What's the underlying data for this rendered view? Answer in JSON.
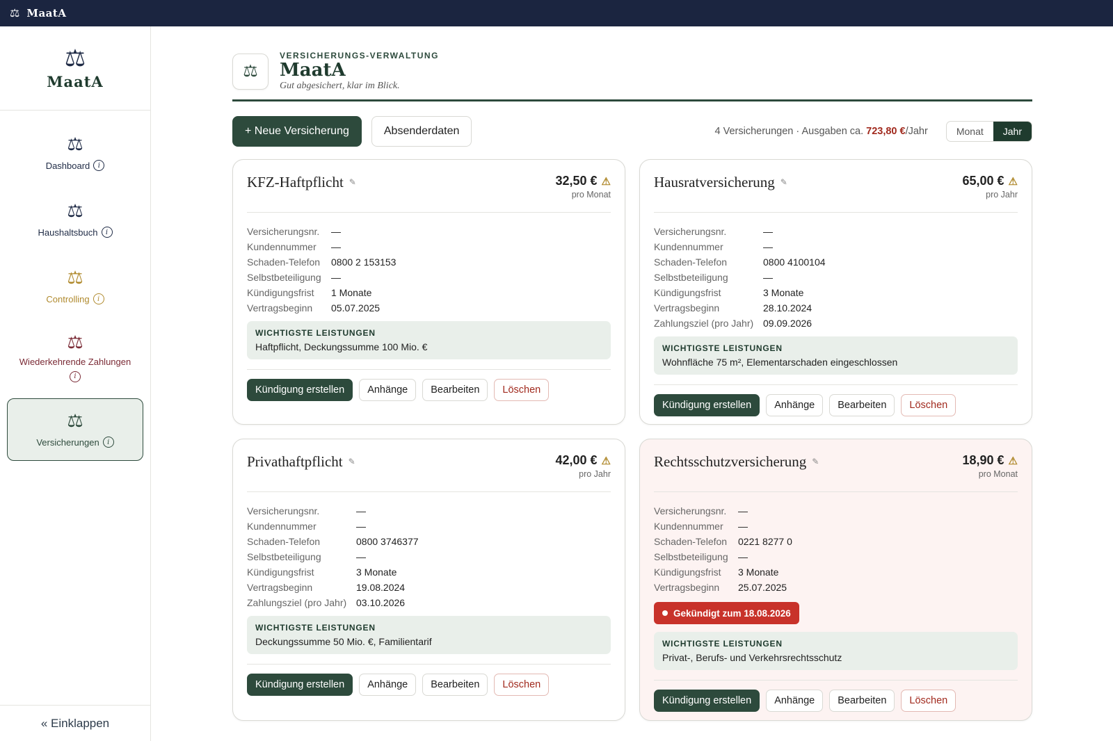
{
  "topbar": {
    "logo": "⚖",
    "title": "MaatA"
  },
  "sidebar": {
    "brand": {
      "icon": "⚖",
      "name": "MaatA"
    },
    "items": [
      {
        "label": "Dashboard",
        "icon": "scale-icon"
      },
      {
        "label": "Haushaltsbuch",
        "icon": "scale-icon"
      },
      {
        "label": "Controlling",
        "icon": "scale-icon"
      },
      {
        "label": "Wiederkehrende Zahlungen",
        "icon": "scale-icon"
      },
      {
        "label": "Versicherungen",
        "icon": "scale-icon"
      }
    ],
    "info_glyph": "i",
    "collapse": "« Einklappen"
  },
  "header": {
    "icon": "⚖",
    "eyebrow": "VERSICHERUNGS-VERWALTUNG",
    "title": "MaatA",
    "subtitle": "Gut abgesichert, klar im Blick."
  },
  "toolbar": {
    "new_label": "+ Neue Versicherung",
    "sender_label": "Absenderdaten",
    "summary_prefix": "4 Versicherungen · Ausgaben ca.",
    "summary_amount": "723,80 €",
    "summary_suffix": "/Jahr",
    "toggle": [
      "Monat",
      "Jahr"
    ]
  },
  "labels": {
    "versicherungsnr": "Versicherungsnr.",
    "kundennummer": "Kundennummer",
    "schaden_telefon": "Schaden-Telefon",
    "selbstbeteiligung": "Selbstbeteiligung",
    "kuendigungsfrist": "Kündigungsfrist",
    "vertragsbeginn": "Vertragsbeginn",
    "zahlungsziel": "Zahlungsziel (pro Jahr)",
    "leistungen": "WICHTIGSTE LEISTUNGEN",
    "btn_kuendigung": "Kündigung erstellen",
    "btn_anhaenge": "Anhänge",
    "btn_bearbeiten": "Bearbeiten",
    "btn_loeschen": "Löschen"
  },
  "cards": [
    {
      "title": "KFZ-Haftpflicht",
      "price": "32,50 €",
      "period": "pro Monat",
      "versicherungsnr": "—",
      "kundennummer": "—",
      "schaden_telefon": "0800 2 153153",
      "selbstbeteiligung": "—",
      "kuendigungsfrist": "1 Monate",
      "vertragsbeginn": "05.07.2025",
      "leistungen": "Haftpflicht, Deckungssumme 100 Mio. €"
    },
    {
      "title": "Hausratversicherung",
      "price": "65,00 €",
      "period": "pro Jahr",
      "versicherungsnr": "—",
      "kundennummer": "—",
      "schaden_telefon": "0800 4100104",
      "selbstbeteiligung": "—",
      "kuendigungsfrist": "3 Monate",
      "vertragsbeginn": "28.10.2024",
      "zahlungsziel": "09.09.2026",
      "leistungen": "Wohnfläche 75 m², Elementarschaden eingeschlossen"
    },
    {
      "title": "Privathaftpflicht",
      "price": "42,00 €",
      "period": "pro Jahr",
      "versicherungsnr": "—",
      "kundennummer": "—",
      "schaden_telefon": "0800 3746377",
      "selbstbeteiligung": "—",
      "kuendigungsfrist": "3 Monate",
      "vertragsbeginn": "19.08.2024",
      "zahlungsziel": "03.10.2026",
      "leistungen": "Deckungssumme 50 Mio. €, Familientarif"
    },
    {
      "title": "Rechtsschutzversicherung",
      "price": "18,90 €",
      "period": "pro Monat",
      "versicherungsnr": "—",
      "kundennummer": "—",
      "schaden_telefon": "0221 8277 0",
      "selbstbeteiligung": "—",
      "kuendigungsfrist": "3 Monate",
      "vertragsbeginn": "25.07.2025",
      "cancelled": "Gekündigt zum 18.08.2026",
      "leistungen": "Privat-, Berufs- und Verkehrsrechtsschutz"
    }
  ],
  "colors": {
    "accent": "#2d4a3c",
    "topbar": "#1b2540",
    "danger": "#c8322a",
    "gold": "#b08a2e",
    "wine": "#7a2a35"
  }
}
